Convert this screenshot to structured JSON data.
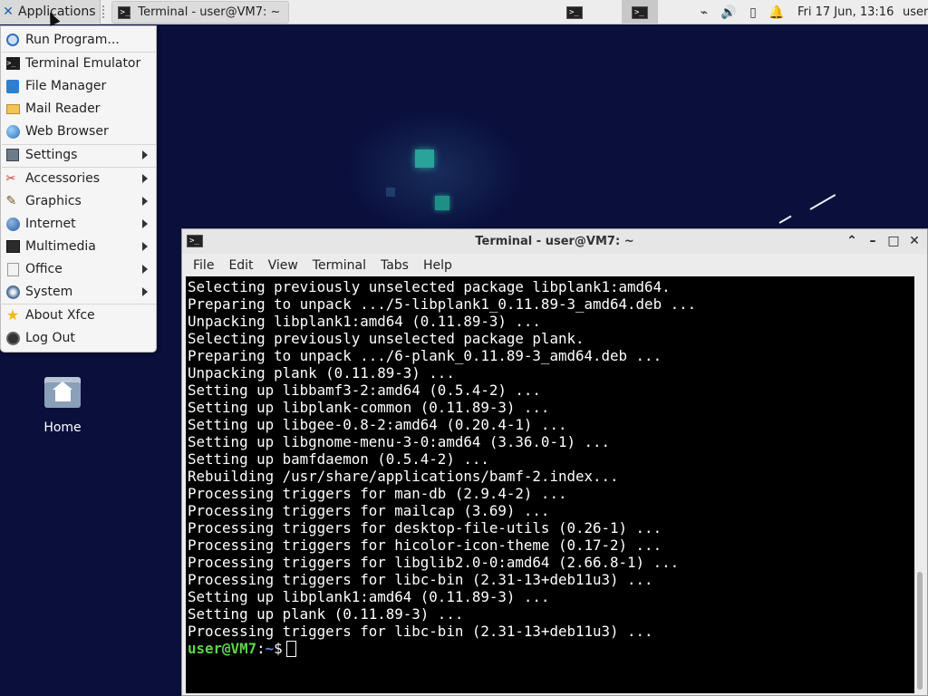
{
  "panel": {
    "apps_label": "Applications",
    "task_title": "Terminal - user@VM7: ~",
    "clock": "Fri 17 Jun, 13:16",
    "user": "user",
    "tray_icons": [
      "network-icon",
      "volume-icon",
      "battery-icon",
      "notification-bell-icon"
    ]
  },
  "menu": {
    "items": [
      {
        "label": "Run Program...",
        "icon": "run-program-icon"
      },
      {
        "label": "Terminal Emulator",
        "icon": "terminal-icon"
      },
      {
        "label": "File Manager",
        "icon": "file-manager-icon"
      },
      {
        "label": "Mail Reader",
        "icon": "mail-icon"
      },
      {
        "label": "Web Browser",
        "icon": "web-browser-icon"
      },
      {
        "label": "Settings",
        "icon": "settings-icon",
        "submenu": true
      },
      {
        "label": "Accessories",
        "icon": "accessories-icon",
        "submenu": true
      },
      {
        "label": "Graphics",
        "icon": "graphics-icon",
        "submenu": true
      },
      {
        "label": "Internet",
        "icon": "internet-icon",
        "submenu": true
      },
      {
        "label": "Multimedia",
        "icon": "multimedia-icon",
        "submenu": true
      },
      {
        "label": "Office",
        "icon": "office-icon",
        "submenu": true
      },
      {
        "label": "System",
        "icon": "system-icon",
        "submenu": true
      },
      {
        "label": "About Xfce",
        "icon": "about-star-icon"
      },
      {
        "label": "Log Out",
        "icon": "logout-icon"
      }
    ]
  },
  "desktop": {
    "home_label": "Home"
  },
  "terminal": {
    "title": "Terminal - user@VM7: ~",
    "menus": [
      "File",
      "Edit",
      "View",
      "Terminal",
      "Tabs",
      "Help"
    ],
    "lines": [
      "Selecting previously unselected package libplank1:amd64.",
      "Preparing to unpack .../5-libplank1_0.11.89-3_amd64.deb ...",
      "Unpacking libplank1:amd64 (0.11.89-3) ...",
      "Selecting previously unselected package plank.",
      "Preparing to unpack .../6-plank_0.11.89-3_amd64.deb ...",
      "Unpacking plank (0.11.89-3) ...",
      "Setting up libbamf3-2:amd64 (0.5.4-2) ...",
      "Setting up libplank-common (0.11.89-3) ...",
      "Setting up libgee-0.8-2:amd64 (0.20.4-1) ...",
      "Setting up libgnome-menu-3-0:amd64 (3.36.0-1) ...",
      "Setting up bamfdaemon (0.5.4-2) ...",
      "Rebuilding /usr/share/applications/bamf-2.index...",
      "Processing triggers for man-db (2.9.4-2) ...",
      "Processing triggers for mailcap (3.69) ...",
      "Processing triggers for desktop-file-utils (0.26-1) ...",
      "Processing triggers for hicolor-icon-theme (0.17-2) ...",
      "Processing triggers for libglib2.0-0:amd64 (2.66.8-1) ...",
      "Processing triggers for libc-bin (2.31-13+deb11u3) ...",
      "Setting up libplank1:amd64 (0.11.89-3) ...",
      "Setting up plank (0.11.89-3) ...",
      "Processing triggers for libc-bin (2.31-13+deb11u3) ..."
    ],
    "prompt_user": "user@VM7",
    "prompt_sep": ":",
    "prompt_path": "~",
    "prompt_symbol": "$"
  },
  "colors": {
    "desktop_bg": "#0a0f3c",
    "prompt_user": "#5ed44a",
    "prompt_path": "#5a8ad6"
  }
}
